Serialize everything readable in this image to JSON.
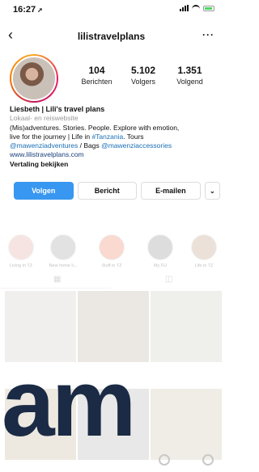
{
  "status": {
    "time": "16:27"
  },
  "nav": {
    "back_glyph": "‹",
    "username": "lilistravelplans",
    "more_glyph": "···"
  },
  "stats": [
    {
      "num": "104",
      "label": "Berichten"
    },
    {
      "num": "5.102",
      "label": "Volgers"
    },
    {
      "num": "1.351",
      "label": "Volgend"
    }
  ],
  "bio": {
    "name": "Liesbeth | Lili's travel plans",
    "category": "Lokaal- en reiswebsite",
    "line1": "(Mis)adventures. Stories. People. Explore with emotion,",
    "line2_a": "live for the journey | Life in ",
    "line2_tag": "#Tanzania",
    "line2_b": ". Tours",
    "line3_tag1": "@mawenziadventures",
    "line3_mid": " / Bags ",
    "line3_tag2": "@mawenziaccessories",
    "website": "www.lilistravelplans.com",
    "translation": "Vertaling bekijken"
  },
  "actions": {
    "follow": "Volgen",
    "message": "Bericht",
    "email": "E-mailen",
    "more": "⌄"
  },
  "highlights": [
    {
      "label": "Living in TZ"
    },
    {
      "label": "New home li..."
    },
    {
      "label": "Stuff in TZ"
    },
    {
      "label": "My FU"
    },
    {
      "label": "Life in TZ"
    }
  ],
  "overlay_text": "am",
  "colors": {
    "accent": "#3897f0",
    "link": "#1a6fb5",
    "overlay_text": "#1b2b45"
  }
}
